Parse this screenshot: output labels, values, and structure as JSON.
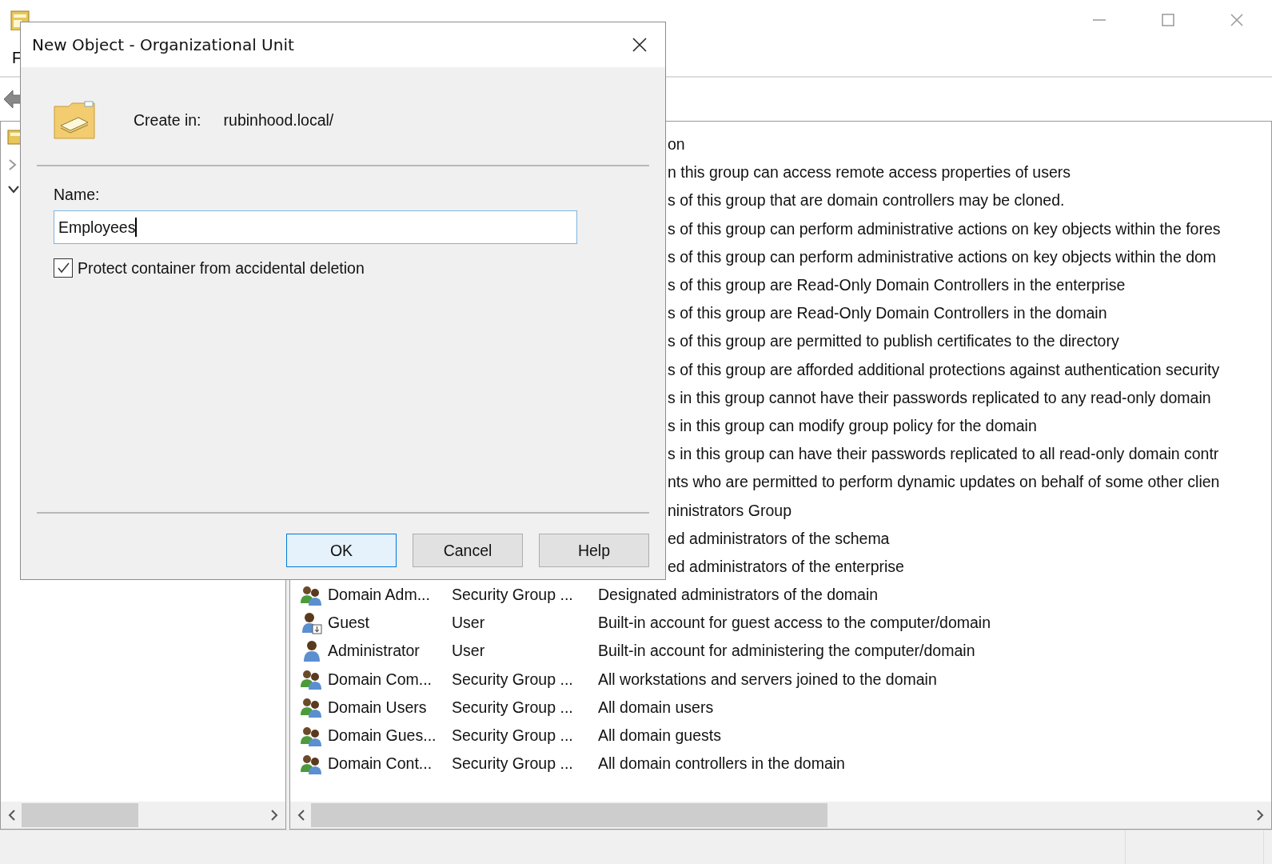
{
  "main_window": {
    "menu": [
      "F"
    ]
  },
  "list": {
    "column_header": "on",
    "rows": [
      {
        "description": "n this group can access remote access properties of users"
      },
      {
        "description": "s of this group that are domain controllers may be cloned."
      },
      {
        "description": "s of this group can perform administrative actions on key objects within the fores"
      },
      {
        "description": "s of this group can perform administrative actions on key objects within the dom"
      },
      {
        "description": "s of this group are Read-Only Domain Controllers in the enterprise"
      },
      {
        "description": "s of this group are Read-Only Domain Controllers in the domain"
      },
      {
        "description": "s of this group are permitted to publish certificates to the directory"
      },
      {
        "description": "s of this group are afforded additional protections against authentication security"
      },
      {
        "description": "s in this group cannot have their passwords replicated to any read-only domain"
      },
      {
        "description": "s in this group can modify group policy for the domain"
      },
      {
        "description": "s in this group can have their passwords replicated to all read-only domain contr"
      },
      {
        "description": "nts who are permitted to perform dynamic updates on behalf of some other clien"
      },
      {
        "description": "ninistrators Group"
      },
      {
        "description": "ed administrators of the schema"
      },
      {
        "description": "ed administrators of the enterprise"
      },
      {
        "kind": "group",
        "name": "Domain Adm...",
        "type": "Security Group ...",
        "description": "Designated administrators of the domain"
      },
      {
        "kind": "guest",
        "name": "Guest",
        "type": "User",
        "description": "Built-in account for guest access to the computer/domain"
      },
      {
        "kind": "user",
        "name": "Administrator",
        "type": "User",
        "description": "Built-in account for administering the computer/domain"
      },
      {
        "kind": "group",
        "name": "Domain Com...",
        "type": "Security Group ...",
        "description": "All workstations and servers joined to the domain"
      },
      {
        "kind": "group",
        "name": "Domain Users",
        "type": "Security Group ...",
        "description": "All domain users"
      },
      {
        "kind": "group",
        "name": "Domain Gues...",
        "type": "Security Group ...",
        "description": "All domain guests"
      },
      {
        "kind": "group",
        "name": "Domain Cont...",
        "type": "Security Group ...",
        "description": "All domain controllers in the domain"
      }
    ]
  },
  "dialog": {
    "title": "New Object - Organizational Unit",
    "create_in_label": "Create in:",
    "create_in_value": "rubinhood.local/",
    "name_label": "Name:",
    "name_value": "Employees",
    "protect": {
      "label": "Protect container from accidental deletion",
      "checked": true
    },
    "buttons": [
      {
        "label": "OK",
        "default": true
      },
      {
        "label": "Cancel",
        "default": false
      },
      {
        "label": "Help",
        "default": false
      }
    ]
  }
}
